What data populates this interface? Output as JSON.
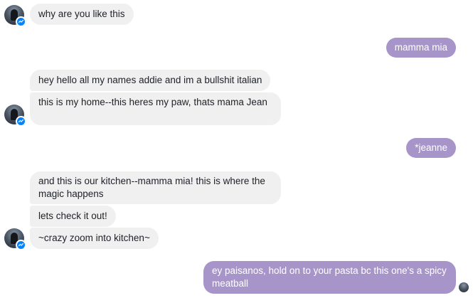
{
  "colors": {
    "received_bubble": "#f1f0f0",
    "sent_bubble": "#a795c9",
    "received_text": "#1d2129",
    "sent_text": "#ffffff",
    "messenger_badge": "#0084ff"
  },
  "conversation": {
    "messages": [
      {
        "direction": "received",
        "text": "why are you like this"
      },
      {
        "direction": "sent",
        "text": "mamma mia"
      },
      {
        "direction": "received",
        "text": "hey hello all my names addie and im a bullshit italian"
      },
      {
        "direction": "received",
        "text": "this is my home--this heres my paw, thats mama Jean"
      },
      {
        "direction": "sent",
        "text": "*jeanne"
      },
      {
        "direction": "received",
        "text": "and this is our kitchen--mamma mia! this is where the magic happens"
      },
      {
        "direction": "received",
        "text": "lets check  it out!"
      },
      {
        "direction": "received",
        "text": "~crazy zoom into kitchen~"
      },
      {
        "direction": "sent",
        "text": "ey paisanos, hold on to your pasta bc this one's a spicy meatball"
      }
    ]
  },
  "icons": {
    "avatar": "contact-avatar-icon",
    "badge": "messenger-badge-icon",
    "seen": "seen-avatar-icon"
  }
}
